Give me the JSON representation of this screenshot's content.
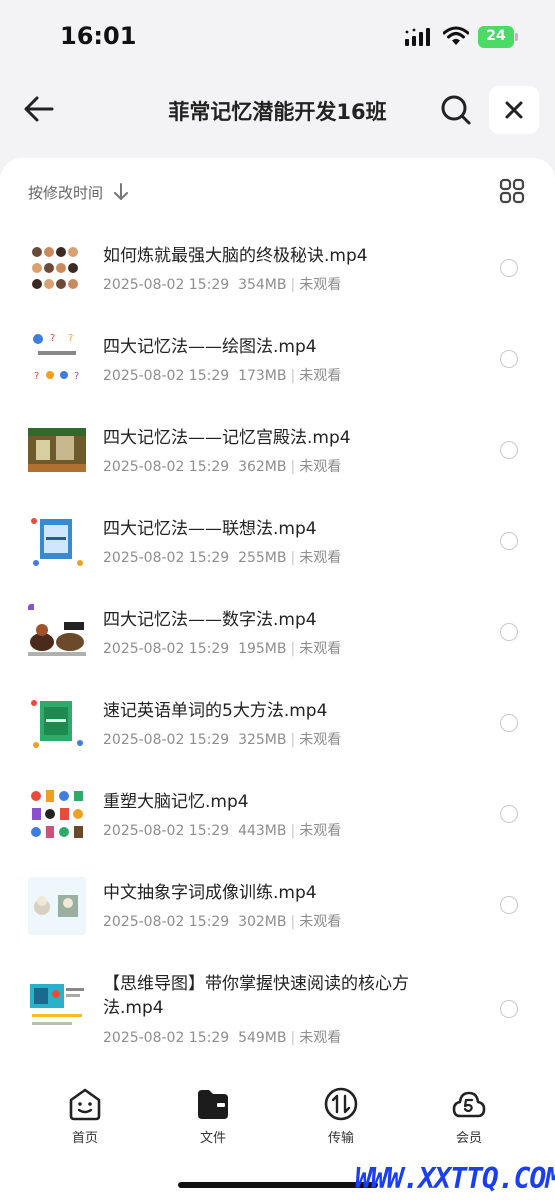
{
  "status": {
    "time": "16:01",
    "battery": "24"
  },
  "header": {
    "title": "菲常记忆潜能开发16班"
  },
  "sort": {
    "label": "按修改时间"
  },
  "files": [
    {
      "name": "如何炼就最强大脑的终极秘诀.mp4",
      "date": "2025-08-02 15:29",
      "size": "354MB",
      "status": "未观看"
    },
    {
      "name": " 四大记忆法——绘图法.mp4",
      "date": "2025-08-02 15:29",
      "size": "173MB",
      "status": "未观看"
    },
    {
      "name": "  四大记忆法——记忆宫殿法.mp4",
      "date": "2025-08-02 15:29",
      "size": "362MB",
      "status": "未观看"
    },
    {
      "name": " 四大记忆法——联想法.mp4",
      "date": "2025-08-02 15:29",
      "size": "255MB",
      "status": "未观看"
    },
    {
      "name": " 四大记忆法——数字法.mp4",
      "date": "2025-08-02 15:29",
      "size": "195MB",
      "status": "未观看"
    },
    {
      "name": "速记英语单词的5大方法.mp4",
      "date": "2025-08-02 15:29",
      "size": "325MB",
      "status": "未观看"
    },
    {
      "name": "重塑大脑记忆.mp4",
      "date": "2025-08-02 15:29",
      "size": "443MB",
      "status": "未观看"
    },
    {
      "name": "中文抽象字词成像训练.mp4",
      "date": "2025-08-02 15:29",
      "size": "302MB",
      "status": "未观看"
    },
    {
      "name": "【思维导图】带你掌握快速阅读的核心方法.mp4",
      "date": "2025-08-02 15:29",
      "size": "549MB",
      "status": "未观看"
    }
  ],
  "nav": {
    "home": "首页",
    "files": "文件",
    "transfer": "传输",
    "member": "会员"
  },
  "watermark": "WWW.XXTTQ.COM",
  "colors": {
    "accent": "#1a3ff0",
    "battery": "#4cd964"
  }
}
